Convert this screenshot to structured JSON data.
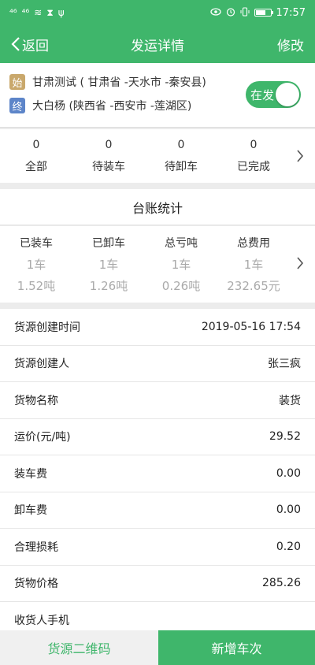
{
  "colors": {
    "brand": "#3fb66b",
    "start_badge": "#c9a86c",
    "end_badge": "#5d85c9"
  },
  "status_bar": {
    "signal_1": "⁴⁶",
    "signal_2": "⁴⁶",
    "wifi": "≋",
    "hourglass": "⧗",
    "usb": "ψ",
    "time": "17:57",
    "battery_level": 0.7
  },
  "header": {
    "back_label": "返回",
    "title": "发运详情",
    "edit_label": "修改"
  },
  "route": {
    "start_badge": "始",
    "start_text": "甘肃测试 ( 甘肃省 -天水市 -秦安县)",
    "end_badge": "终",
    "end_text": "大白杨 (陕西省 -西安市 -莲湖区)",
    "toggle_label": "在发"
  },
  "status_counts": [
    {
      "count": "0",
      "label": "全部"
    },
    {
      "count": "0",
      "label": "待装车"
    },
    {
      "count": "0",
      "label": "待卸车"
    },
    {
      "count": "0",
      "label": "已完成"
    }
  ],
  "ledger": {
    "title": "台账统计",
    "columns": [
      {
        "label": "已装车",
        "count": "1车",
        "amount": "1.52吨"
      },
      {
        "label": "已卸车",
        "count": "1车",
        "amount": "1.26吨"
      },
      {
        "label": "总亏吨",
        "count": "1车",
        "amount": "0.26吨"
      },
      {
        "label": "总费用",
        "count": "1车",
        "amount": "232.65元"
      }
    ]
  },
  "details": [
    {
      "label": "货源创建时间",
      "value": "2019-05-16 17:54"
    },
    {
      "label": "货源创建人",
      "value": "张三疯"
    },
    {
      "label": "货物名称",
      "value": "装货"
    },
    {
      "label": "运价(元/吨)",
      "value": "29.52"
    },
    {
      "label": "装车费",
      "value": "0.00"
    },
    {
      "label": "卸车费",
      "value": "0.00"
    },
    {
      "label": "合理损耗",
      "value": "0.20"
    },
    {
      "label": "货物价格",
      "value": "285.26"
    },
    {
      "label": "收货人手机",
      "value": ""
    }
  ],
  "bottom": {
    "qr_label": "货源二维码",
    "add_label": "新增车次"
  }
}
